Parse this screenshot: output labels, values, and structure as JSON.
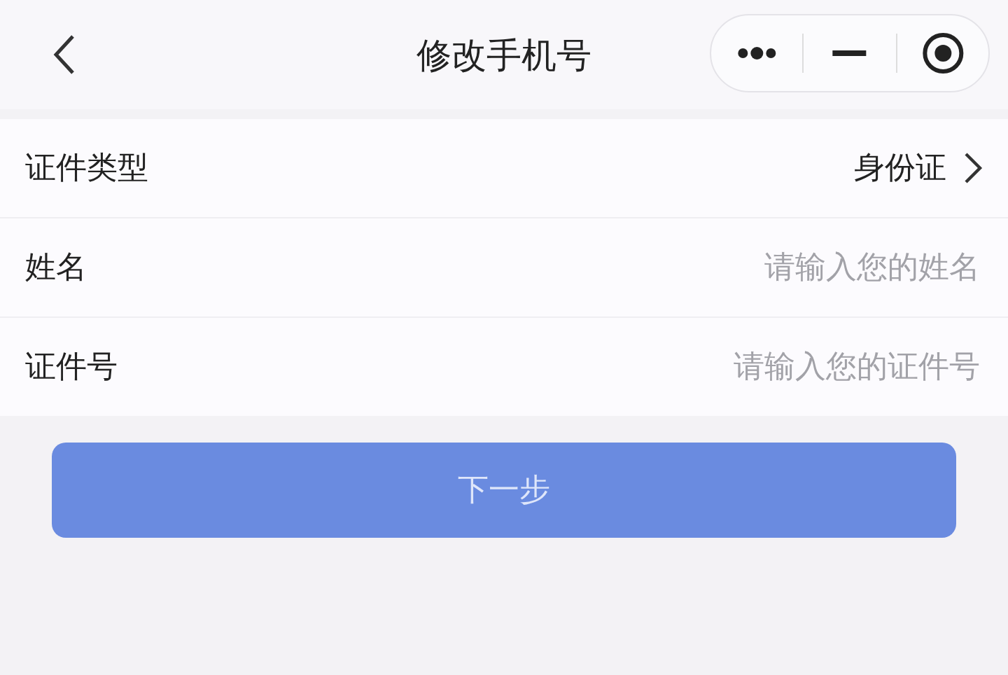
{
  "nav_bar": {
    "title": "修改手机号"
  },
  "form_rows": [
    {
      "kind": "select",
      "label": "证件类型",
      "value": "身份证"
    },
    {
      "kind": "input",
      "label": "姓名",
      "placeholder": "请输入您的姓名"
    },
    {
      "kind": "input",
      "label": "证件号",
      "placeholder": "请输入您的证件号"
    }
  ],
  "next_button": {
    "label": "下一步"
  }
}
